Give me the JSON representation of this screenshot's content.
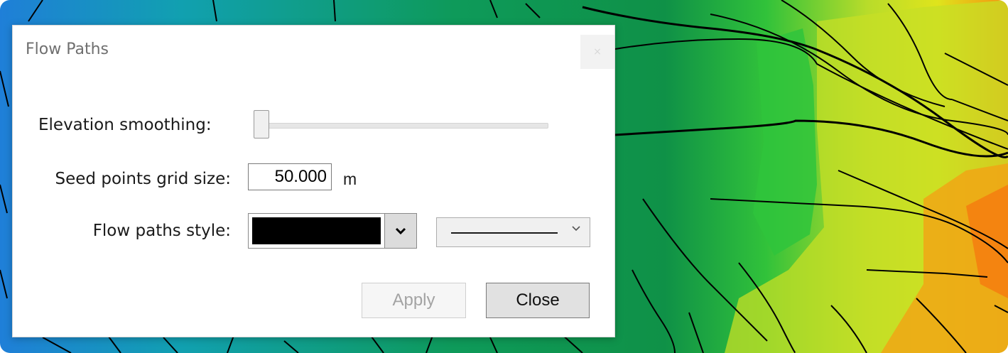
{
  "dialog": {
    "title": "Flow Paths",
    "close_glyph": "×",
    "elevation_smoothing_label": "Elevation smoothing:",
    "elevation_smoothing_value": 0.0,
    "seed_grid_label": "Seed points grid size:",
    "seed_grid_value": "50.000",
    "seed_grid_unit": "m",
    "flow_style_label": "Flow paths style:",
    "flow_style_color": "#000000",
    "flow_style_line": "solid",
    "apply_label": "Apply",
    "close_label": "Close"
  },
  "icons": {
    "color_dropdown": "chevron-down-icon",
    "line_dropdown": "chevron-down-icon",
    "dialog_close": "close-icon"
  },
  "colors": {
    "terrain_low": "#1f7fd8",
    "terrain_mid": "#0f9a55",
    "terrain_green": "#2fbf36",
    "terrain_yellow": "#d8e21a",
    "terrain_high": "#f28c12",
    "flow_lines": "#000000"
  }
}
